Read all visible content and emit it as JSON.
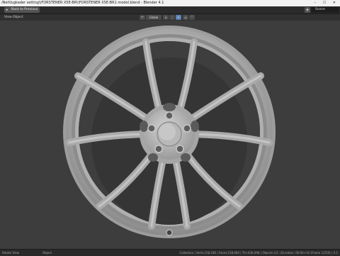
{
  "window": {
    "title": "/NetVugkader setting\\\\FORSTENER X5E-BR\\\\FORSTENER X5E-BR1 model.blend - Blender 4.1",
    "controls": "– ☐ ✕"
  },
  "topbar": {
    "back_label": "Back to Previous",
    "scene_label": "Scene"
  },
  "viewport_header": {
    "menu": [
      "View",
      "Object"
    ],
    "orientation_label": "Global"
  },
  "statusbar": {
    "left_label": "Rotate View",
    "mid_label": "Object",
    "right_label": "Collection | Verts:218,186 | Faces:218,064 | Tris:436,098 | Objects:1/1 | Duration: 00:00+10 (Frame 1/250) | 4.1"
  },
  "colors": {
    "viewport_bg": "#3d3d3d",
    "wheel_face": "#b8b8b8",
    "wheel_shadow": "#7d7d7d",
    "accent": "#5a7fb3"
  }
}
